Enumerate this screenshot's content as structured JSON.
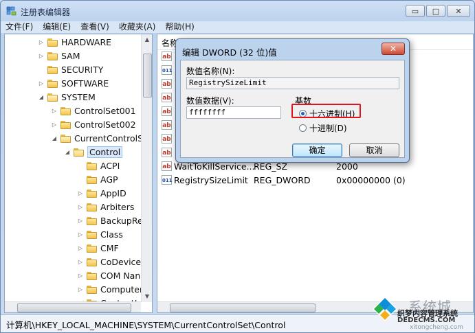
{
  "window": {
    "title": "注册表编辑器",
    "controls": {
      "minimize": "▭",
      "restore": "□",
      "close": "✕"
    }
  },
  "menu": [
    "文件(F)",
    "编辑(E)",
    "查看(V)",
    "收藏夹(A)",
    "帮助(H)"
  ],
  "tree": [
    {
      "label": "HARDWARE",
      "level": 0,
      "expander": "▷"
    },
    {
      "label": "SAM",
      "level": 0,
      "expander": "▷"
    },
    {
      "label": "SECURITY",
      "level": 0,
      "expander": ""
    },
    {
      "label": "SOFTWARE",
      "level": 0,
      "expander": "▷"
    },
    {
      "label": "SYSTEM",
      "level": 0,
      "expander": "◢"
    },
    {
      "label": "ControlSet001",
      "level": 1,
      "expander": "▷"
    },
    {
      "label": "ControlSet002",
      "level": 1,
      "expander": "▷"
    },
    {
      "label": "CurrentControlSe",
      "level": 1,
      "expander": "◢"
    },
    {
      "label": "Control",
      "level": 2,
      "expander": "◢",
      "selected": true
    },
    {
      "label": "ACPI",
      "level": 3,
      "expander": ""
    },
    {
      "label": "AGP",
      "level": 3,
      "expander": ""
    },
    {
      "label": "AppID",
      "level": 3,
      "expander": "▷"
    },
    {
      "label": "Arbiters",
      "level": 3,
      "expander": "▷"
    },
    {
      "label": "BackupRe",
      "level": 3,
      "expander": "▷"
    },
    {
      "label": "Class",
      "level": 3,
      "expander": "▷"
    },
    {
      "label": "CMF",
      "level": 3,
      "expander": "▷"
    },
    {
      "label": "CoDeviceI",
      "level": 3,
      "expander": "▷"
    },
    {
      "label": "COM Nan",
      "level": 3,
      "expander": "▷"
    },
    {
      "label": "Computer",
      "level": 3,
      "expander": "▷"
    },
    {
      "label": "ContentI",
      "level": 3,
      "expander": ""
    }
  ],
  "list": {
    "header_name": "名称",
    "rows": [
      {
        "icon": "ab",
        "name": "",
        "type": "",
        "data": ""
      },
      {
        "icon": "bin",
        "name": "",
        "type": "",
        "data": ""
      },
      {
        "icon": "ab",
        "name": "",
        "type": "",
        "data": ""
      },
      {
        "icon": "ab",
        "name": "",
        "type": "",
        "data": "(0)partition(1)"
      },
      {
        "icon": "ab",
        "name": "",
        "type": "",
        "data": "stedinstaller"
      },
      {
        "icon": "ab",
        "name": "",
        "type": "",
        "data": "tem32\\scext.dl"
      },
      {
        "icon": "ab",
        "name": "",
        "type": "",
        "data": "(0)partition(1)"
      },
      {
        "icon": "ab",
        "name": "",
        "type": "",
        "data": "OUT"
      },
      {
        "icon": "ab",
        "name": "WaitToKillService...",
        "type": "REG_SZ",
        "data": "2000"
      },
      {
        "icon": "bin",
        "name": "RegistrySizeLimit",
        "type": "REG_DWORD",
        "data": "0x00000000 (0)"
      }
    ]
  },
  "status": "计算机\\HKEY_LOCAL_MACHINE\\SYSTEM\\CurrentControlSet\\Control",
  "dialog": {
    "title": "编辑 DWORD (32 位)值",
    "close": "✕",
    "name_label": "数值名称(N):",
    "name_value": "RegistrySizeLimit",
    "data_label": "数值数据(V):",
    "data_value": "ffffffff",
    "base_label": "基数",
    "hex_label": "十六进制(H)",
    "dec_label": "十进制(D)",
    "hex_selected": true,
    "ok": "确定",
    "cancel": "取消"
  },
  "watermark": {
    "t1": "系统城",
    "t2": "织梦内容管理系统",
    "t3": "DEDECMS.COM",
    "t4": "xitongcheng.com"
  }
}
